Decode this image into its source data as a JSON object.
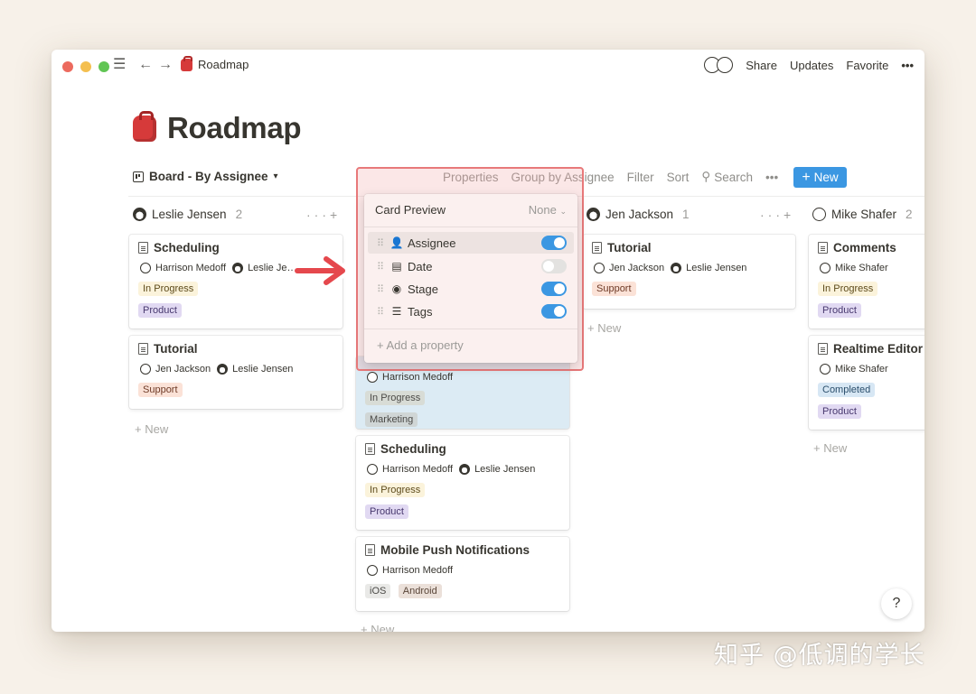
{
  "topbar": {
    "breadcrumb": "Roadmap",
    "share": "Share",
    "updates": "Updates",
    "favorite": "Favorite",
    "more": "•••"
  },
  "page": {
    "title": "Roadmap"
  },
  "viewbar": {
    "view_name": "Board - By Assignee",
    "properties": "Properties",
    "group_by": "Group by Assignee",
    "filter": "Filter",
    "sort": "Sort",
    "search": "Search",
    "more": "•••",
    "new_label": "New"
  },
  "columns": [
    {
      "name": "Leslie Jensen",
      "count": "2",
      "cards": [
        {
          "title": "Scheduling",
          "people": [
            "Harrison Medoff",
            "Leslie Je…"
          ],
          "tags": [
            "In Progress",
            "Product"
          ]
        },
        {
          "title": "Tutorial",
          "people": [
            "Jen Jackson",
            "Leslie Jensen"
          ],
          "tags": [
            "Support"
          ]
        }
      ],
      "add_label": "New"
    },
    {
      "name": "",
      "count": "",
      "cards": [
        {
          "title": "",
          "people": [
            "Harrison Medoff"
          ],
          "tags": [
            "In Progress",
            "Marketing"
          ]
        },
        {
          "title": "Scheduling",
          "people": [
            "Harrison Medoff",
            "Leslie Jensen"
          ],
          "tags": [
            "In Progress",
            "Product"
          ]
        },
        {
          "title": "Mobile Push Notifications",
          "people": [
            "Harrison Medoff"
          ],
          "tags": [
            "iOS",
            "Android"
          ]
        }
      ],
      "add_label": "New"
    },
    {
      "name": "Jen Jackson",
      "count": "1",
      "cards": [
        {
          "title": "Tutorial",
          "people": [
            "Jen Jackson",
            "Leslie Jensen"
          ],
          "tags": [
            "Support"
          ]
        }
      ],
      "add_label": "New"
    },
    {
      "name": "Mike Shafer",
      "count": "2",
      "cards": [
        {
          "title": "Comments",
          "people": [
            "Mike Shafer"
          ],
          "tags": [
            "In Progress",
            "Product"
          ]
        },
        {
          "title": "Realtime Editor",
          "people": [
            "Mike Shafer"
          ],
          "tags": [
            "Completed",
            "Product"
          ]
        }
      ],
      "add_label": "New"
    }
  ],
  "popup": {
    "header": "Card Preview",
    "header_value": "None",
    "properties": [
      {
        "label": "Assignee",
        "icon": "assignee-icon",
        "enabled": true
      },
      {
        "label": "Date",
        "icon": "calendar-icon",
        "enabled": false
      },
      {
        "label": "Stage",
        "icon": "stage-icon",
        "enabled": true
      },
      {
        "label": "Tags",
        "icon": "list-icon",
        "enabled": true
      }
    ],
    "add_property": "Add a property"
  },
  "help": "?",
  "watermark": "知乎 @低调的学长",
  "colors": {
    "accent": "#3b97e2",
    "highlight_border": "#e8797a",
    "arrow": "#e5484d"
  }
}
